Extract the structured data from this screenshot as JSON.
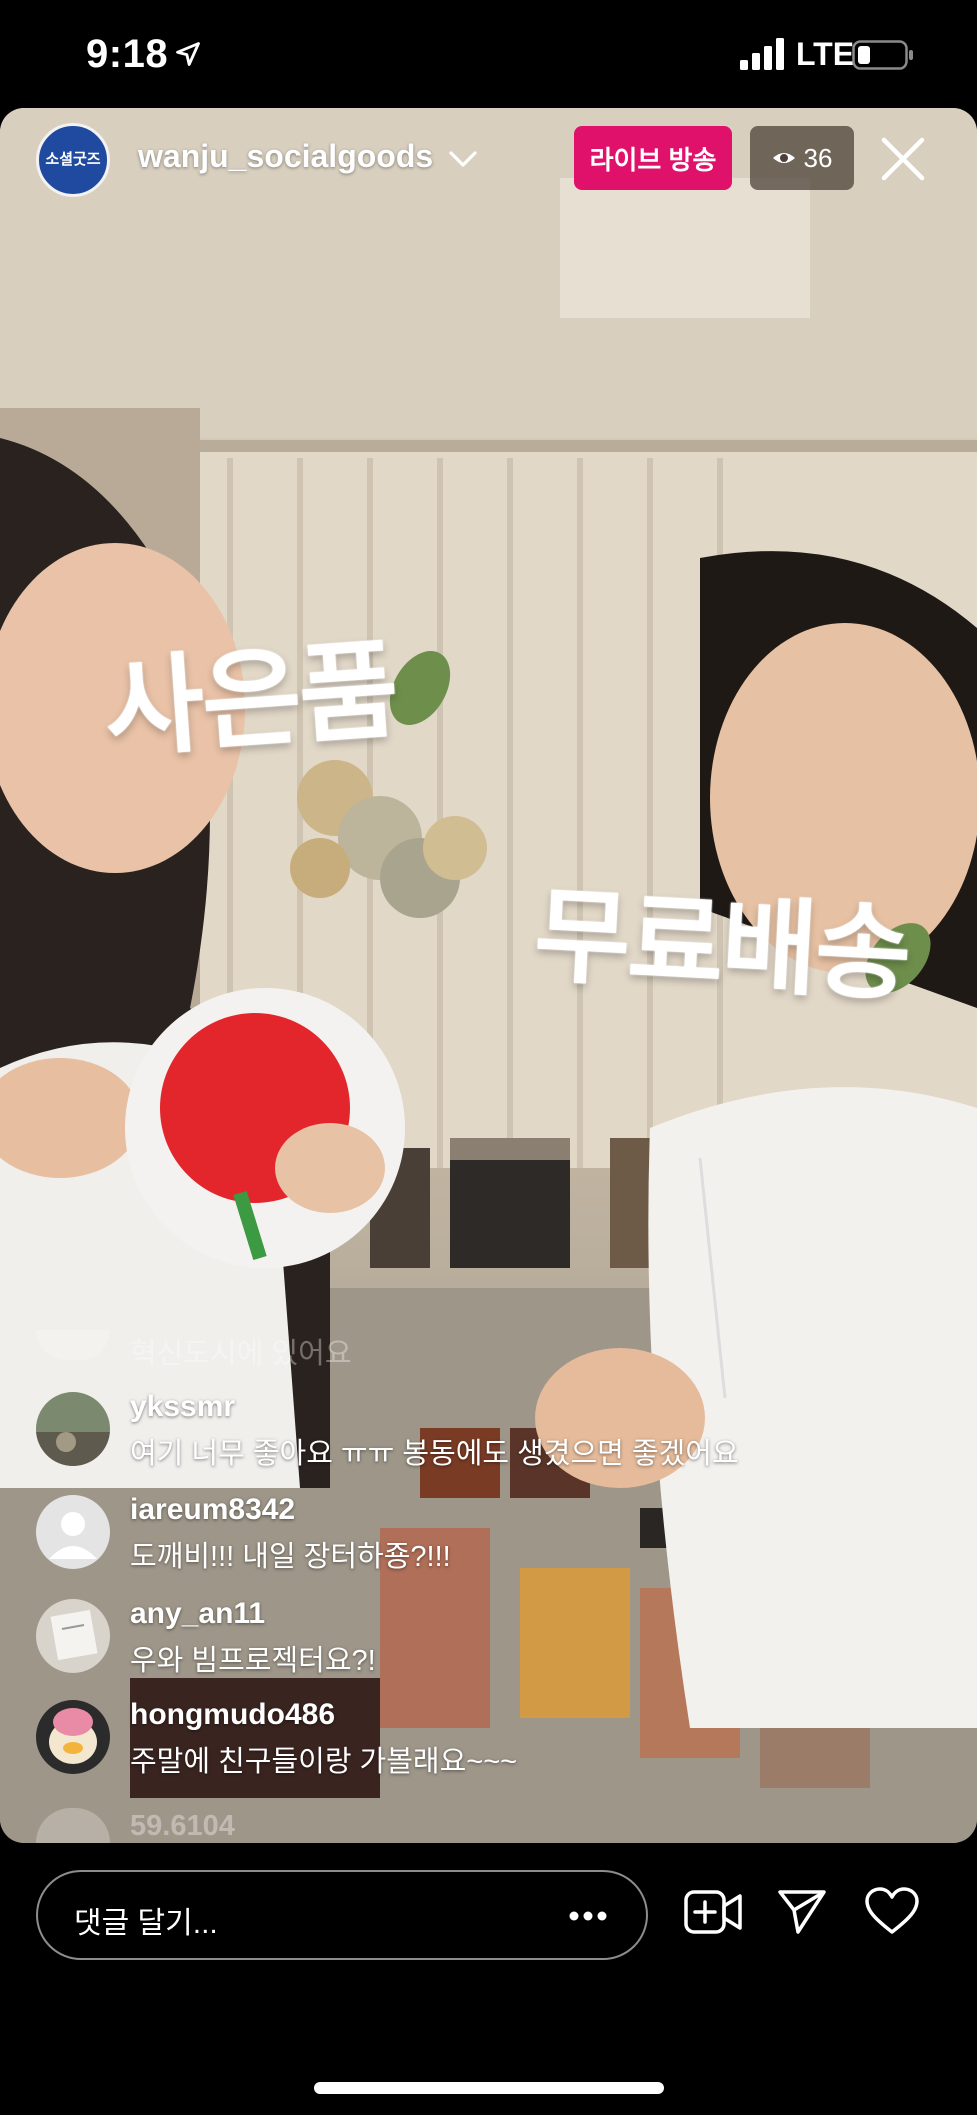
{
  "status_bar": {
    "time": "9:18",
    "network": "LTE"
  },
  "live": {
    "username": "wanju_socialgoods",
    "logo_text": "소셜굿즈",
    "badge_label": "라이브 방송",
    "viewer_count": "36"
  },
  "stickers": {
    "gift": "사은품",
    "free_shipping": "무료배송"
  },
  "comments": {
    "faded_top": "혁신도시에 있어요",
    "items": [
      {
        "user": "ykssmr",
        "text": "여기 너무 좋아요 ㅠㅠ 봉동에도 생겼으면 좋겠어요"
      },
      {
        "user": "iareum8342",
        "text": "도깨비!!! 내일 장터하죵?!!!"
      },
      {
        "user": "any_an11",
        "text": "우와 빔프로젝터요?!"
      },
      {
        "user": "hongmudo486",
        "text": "주말에 친구들이랑 가볼래요~~~"
      }
    ],
    "faded_bottom": "59.6104"
  },
  "bottom_bar": {
    "comment_placeholder": "댓글 달기..."
  },
  "colors": {
    "live_badge": "#e0116b",
    "background": "#000000",
    "logo_blue": "#1f4aa0"
  }
}
